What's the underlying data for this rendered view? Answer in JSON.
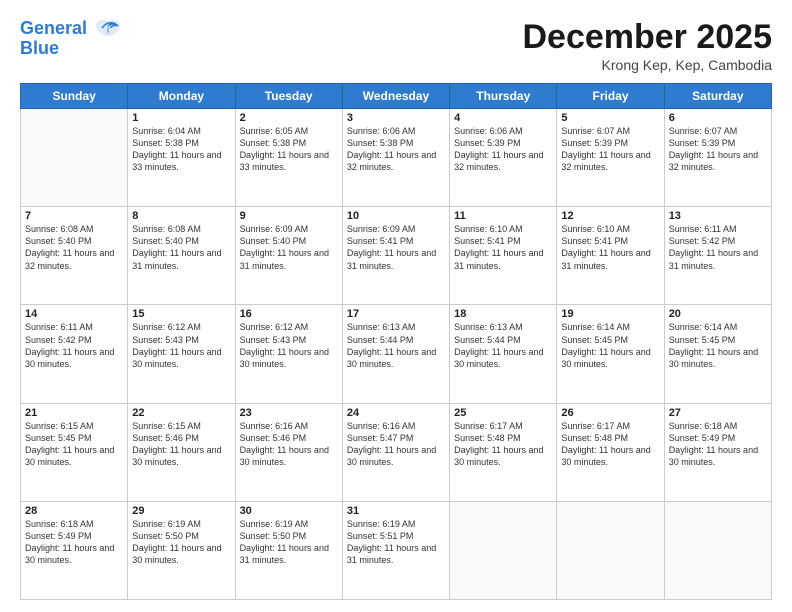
{
  "header": {
    "logo_line1": "General",
    "logo_line2": "Blue",
    "month_title": "December 2025",
    "subtitle": "Krong Kep, Kep, Cambodia"
  },
  "days_of_week": [
    "Sunday",
    "Monday",
    "Tuesday",
    "Wednesday",
    "Thursday",
    "Friday",
    "Saturday"
  ],
  "weeks": [
    [
      {
        "day": "",
        "empty": true
      },
      {
        "day": "1",
        "sunrise": "6:04 AM",
        "sunset": "5:38 PM",
        "daylight": "11 hours and 33 minutes."
      },
      {
        "day": "2",
        "sunrise": "6:05 AM",
        "sunset": "5:38 PM",
        "daylight": "11 hours and 33 minutes."
      },
      {
        "day": "3",
        "sunrise": "6:06 AM",
        "sunset": "5:38 PM",
        "daylight": "11 hours and 32 minutes."
      },
      {
        "day": "4",
        "sunrise": "6:06 AM",
        "sunset": "5:39 PM",
        "daylight": "11 hours and 32 minutes."
      },
      {
        "day": "5",
        "sunrise": "6:07 AM",
        "sunset": "5:39 PM",
        "daylight": "11 hours and 32 minutes."
      },
      {
        "day": "6",
        "sunrise": "6:07 AM",
        "sunset": "5:39 PM",
        "daylight": "11 hours and 32 minutes."
      }
    ],
    [
      {
        "day": "7",
        "sunrise": "6:08 AM",
        "sunset": "5:40 PM",
        "daylight": "11 hours and 32 minutes."
      },
      {
        "day": "8",
        "sunrise": "6:08 AM",
        "sunset": "5:40 PM",
        "daylight": "11 hours and 31 minutes."
      },
      {
        "day": "9",
        "sunrise": "6:09 AM",
        "sunset": "5:40 PM",
        "daylight": "11 hours and 31 minutes."
      },
      {
        "day": "10",
        "sunrise": "6:09 AM",
        "sunset": "5:41 PM",
        "daylight": "11 hours and 31 minutes."
      },
      {
        "day": "11",
        "sunrise": "6:10 AM",
        "sunset": "5:41 PM",
        "daylight": "11 hours and 31 minutes."
      },
      {
        "day": "12",
        "sunrise": "6:10 AM",
        "sunset": "5:41 PM",
        "daylight": "11 hours and 31 minutes."
      },
      {
        "day": "13",
        "sunrise": "6:11 AM",
        "sunset": "5:42 PM",
        "daylight": "11 hours and 31 minutes."
      }
    ],
    [
      {
        "day": "14",
        "sunrise": "6:11 AM",
        "sunset": "5:42 PM",
        "daylight": "11 hours and 30 minutes."
      },
      {
        "day": "15",
        "sunrise": "6:12 AM",
        "sunset": "5:43 PM",
        "daylight": "11 hours and 30 minutes."
      },
      {
        "day": "16",
        "sunrise": "6:12 AM",
        "sunset": "5:43 PM",
        "daylight": "11 hours and 30 minutes."
      },
      {
        "day": "17",
        "sunrise": "6:13 AM",
        "sunset": "5:44 PM",
        "daylight": "11 hours and 30 minutes."
      },
      {
        "day": "18",
        "sunrise": "6:13 AM",
        "sunset": "5:44 PM",
        "daylight": "11 hours and 30 minutes."
      },
      {
        "day": "19",
        "sunrise": "6:14 AM",
        "sunset": "5:45 PM",
        "daylight": "11 hours and 30 minutes."
      },
      {
        "day": "20",
        "sunrise": "6:14 AM",
        "sunset": "5:45 PM",
        "daylight": "11 hours and 30 minutes."
      }
    ],
    [
      {
        "day": "21",
        "sunrise": "6:15 AM",
        "sunset": "5:45 PM",
        "daylight": "11 hours and 30 minutes."
      },
      {
        "day": "22",
        "sunrise": "6:15 AM",
        "sunset": "5:46 PM",
        "daylight": "11 hours and 30 minutes."
      },
      {
        "day": "23",
        "sunrise": "6:16 AM",
        "sunset": "5:46 PM",
        "daylight": "11 hours and 30 minutes."
      },
      {
        "day": "24",
        "sunrise": "6:16 AM",
        "sunset": "5:47 PM",
        "daylight": "11 hours and 30 minutes."
      },
      {
        "day": "25",
        "sunrise": "6:17 AM",
        "sunset": "5:48 PM",
        "daylight": "11 hours and 30 minutes."
      },
      {
        "day": "26",
        "sunrise": "6:17 AM",
        "sunset": "5:48 PM",
        "daylight": "11 hours and 30 minutes."
      },
      {
        "day": "27",
        "sunrise": "6:18 AM",
        "sunset": "5:49 PM",
        "daylight": "11 hours and 30 minutes."
      }
    ],
    [
      {
        "day": "28",
        "sunrise": "6:18 AM",
        "sunset": "5:49 PM",
        "daylight": "11 hours and 30 minutes."
      },
      {
        "day": "29",
        "sunrise": "6:19 AM",
        "sunset": "5:50 PM",
        "daylight": "11 hours and 30 minutes."
      },
      {
        "day": "30",
        "sunrise": "6:19 AM",
        "sunset": "5:50 PM",
        "daylight": "11 hours and 31 minutes."
      },
      {
        "day": "31",
        "sunrise": "6:19 AM",
        "sunset": "5:51 PM",
        "daylight": "11 hours and 31 minutes."
      },
      {
        "day": "",
        "empty": true
      },
      {
        "day": "",
        "empty": true
      },
      {
        "day": "",
        "empty": true
      }
    ]
  ]
}
